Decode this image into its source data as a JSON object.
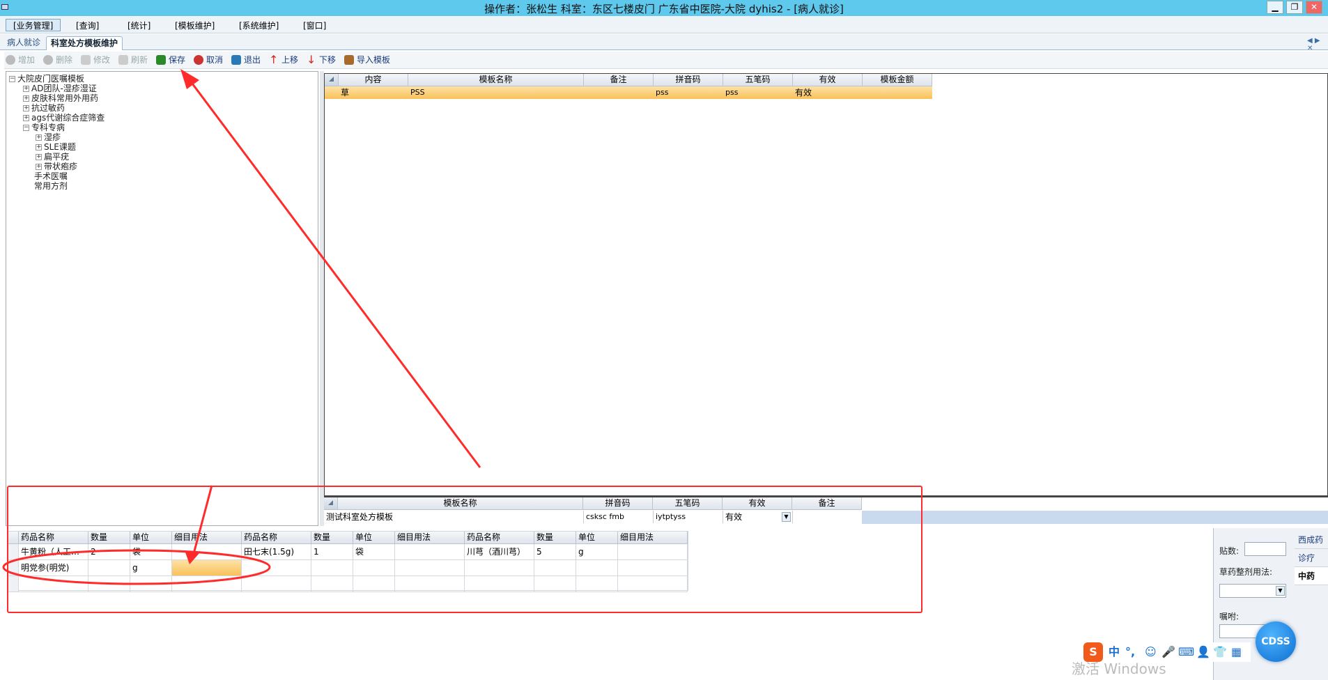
{
  "window": {
    "title": "操作者：张松生  科室：东区七楼皮门  广东省中医院-大院 dyhis2 - [病人就诊]",
    "controls": [
      "▁",
      "❐",
      "✕"
    ]
  },
  "menu": [
    "[业务管理]",
    "[查询]",
    "[统计]",
    "[模板维护]",
    "[系统维护]",
    "[窗口]"
  ],
  "tabs": [
    "病人就诊",
    "科室处方模板维护"
  ],
  "toolbar": {
    "add": "增加",
    "delete": "删除",
    "edit": "修改",
    "refresh": "刷新",
    "save": "保存",
    "cancel": "取消",
    "exit": "退出",
    "up": "上移",
    "down": "下移",
    "import": "导入模板"
  },
  "tree": {
    "root": "大院皮门医嘱模板",
    "items": [
      "AD团队-湿疹湿证",
      "皮肤科常用外用药",
      "抗过敏药",
      "ags代谢综合症筛查",
      "专科专病"
    ],
    "sub": [
      "湿疹",
      "SLE课题",
      "扁平疣",
      "带状疱疹"
    ],
    "tail": [
      "手术医嘱",
      "常用方剂"
    ]
  },
  "upper_grid": {
    "headers": [
      "内容",
      "模板名称",
      "备注",
      "拼音码",
      "五笔码",
      "有效",
      "模板金额"
    ],
    "row": {
      "content": "草",
      "name": "PSS",
      "remark": "",
      "pinyin": "pss",
      "wubi": "pss",
      "valid": "有效",
      "amount": ""
    }
  },
  "lower_grid": {
    "headers": [
      "模板名称",
      "拼音码",
      "五笔码",
      "有效",
      "备注"
    ],
    "row": {
      "name": "测试科室处方模板",
      "pinyin": "csksc fmb",
      "wubi": "iytptyss",
      "valid": "有效",
      "remark": ""
    }
  },
  "rx_grid": {
    "headers": [
      "药品名称",
      "数量",
      "单位",
      "细目用法",
      "药品名称",
      "数量",
      "单位",
      "细目用法",
      "药品名称",
      "数量",
      "单位",
      "细目用法"
    ],
    "rows": [
      [
        "牛黄粉（人工…",
        "2",
        "袋",
        "",
        "田七末(1.5g)",
        "1",
        "袋",
        "",
        "川芎（酒川芎）",
        "5",
        "g",
        ""
      ],
      [
        "明党参(明党)",
        "",
        "g",
        "",
        "",
        "",
        "",
        "",
        "",
        "",
        "",
        ""
      ],
      [
        "",
        "",
        "",
        "",
        "",
        "",
        "",
        "",
        "",
        "",
        "",
        ""
      ]
    ]
  },
  "side": {
    "tie_label": "贴数:",
    "usage_label": "草药整剂用法:",
    "advice_label": "嘱咐:",
    "tabs": [
      "西成药",
      "诊疗",
      "中药"
    ]
  },
  "ime_items": [
    "中",
    "°,",
    "☺",
    "🎤",
    "⌨",
    "👤",
    "👕",
    "▦"
  ],
  "cdss": "CDSS",
  "watermark": "激活 Windows",
  "accent": "#ff2a2a"
}
